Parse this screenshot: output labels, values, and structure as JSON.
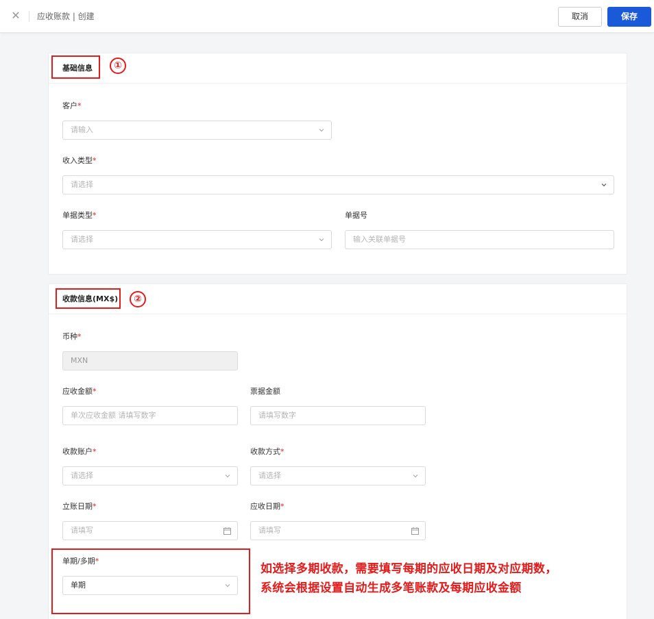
{
  "header": {
    "close_icon": "close-icon",
    "breadcrumb": "应收账款 | 创建",
    "cancel_label": "取消",
    "save_label": "保存",
    "accent_color": "#1a5ad8"
  },
  "section_basic": {
    "title": "基础信息",
    "marker": "①",
    "customer": {
      "label": "客户",
      "required": "*",
      "placeholder": "请输入"
    },
    "income_type": {
      "label": "收入类型",
      "required": "*",
      "placeholder": "请选择"
    },
    "document_type": {
      "label": "单据类型",
      "required": "*",
      "placeholder": "请选择"
    },
    "document_no": {
      "label": "单据号",
      "placeholder": "输入关联单据号"
    }
  },
  "section_payment": {
    "title": "收款信息(MX$)",
    "marker": "②",
    "currency": {
      "label": "币种",
      "required": "*",
      "value": "MXN"
    },
    "receivable_amount": {
      "label": "应收金额",
      "required": "*",
      "placeholder": "单次应收金额 请填写数字"
    },
    "bill_amount": {
      "label": "票据金额",
      "placeholder": "请填写数字"
    },
    "receiving_account": {
      "label": "收款账户",
      "required": "*",
      "placeholder": "请选择"
    },
    "payment_method": {
      "label": "收款方式",
      "required": "*",
      "placeholder": "请选择"
    },
    "booking_date": {
      "label": "立账日期",
      "required": "*",
      "placeholder": "请填写"
    },
    "due_date": {
      "label": "应收日期",
      "required": "*",
      "placeholder": "请填写"
    },
    "period_type": {
      "label": "单期/多期",
      "required": "*",
      "value": "单期"
    }
  },
  "annotation": {
    "line1": "如选择多期收款，需要填写每期的应收日期及对应期数，",
    "line2": "系统会根据设置自动生成多笔账款及每期应收金额",
    "color": "#e31b1b"
  }
}
